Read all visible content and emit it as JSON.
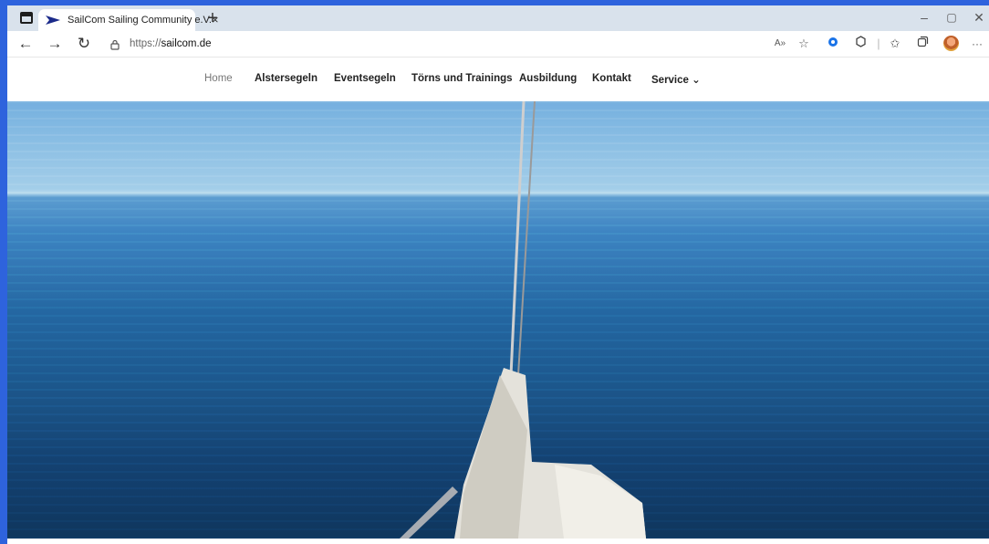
{
  "browser": {
    "tab_title": "SailCom Sailing Community e.V.",
    "tab_close": "×",
    "new_tab": "+",
    "url_scheme": "https://",
    "url_domain": "sailcom.de",
    "window_controls": {
      "minimize": "–",
      "maximize": "▢",
      "close": "✕"
    },
    "nav": {
      "back": "←",
      "forward": "→",
      "refresh": "↻"
    },
    "toolbar_icons": [
      "read-aloud-icon",
      "favorite-add-icon",
      "extension-icon",
      "copilot-icon",
      "favorites-icon",
      "collections-icon",
      "profile-avatar",
      "more-icon"
    ]
  },
  "site_nav": {
    "items": [
      {
        "label": "Home",
        "active": true
      },
      {
        "label": "Alstersegeln"
      },
      {
        "label": "Eventsegeln"
      },
      {
        "label": "Törns und Trainings"
      },
      {
        "label": "Ausbildung"
      },
      {
        "label": "Kontakt"
      },
      {
        "label": "Service ⌄"
      }
    ]
  },
  "colors": {
    "desktop_bg": "#2e63dd",
    "tabstrip_bg": "#d9e2ec",
    "favicon": "#1b2a8a",
    "sea_dark": "#0f3860",
    "sky": "#a6d0ea"
  }
}
